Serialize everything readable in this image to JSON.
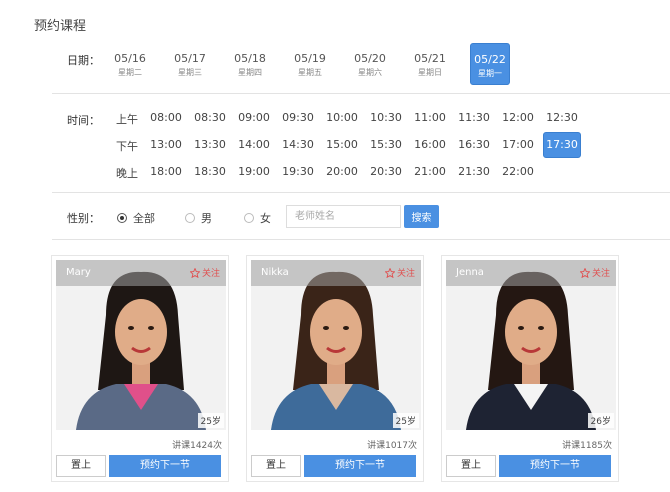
{
  "page_title": "预约课程",
  "dates": {
    "label": "日期：",
    "items": [
      {
        "date": "05/16",
        "weekday": "星期二",
        "active": false
      },
      {
        "date": "05/17",
        "weekday": "星期三",
        "active": false
      },
      {
        "date": "05/18",
        "weekday": "星期四",
        "active": false
      },
      {
        "date": "05/19",
        "weekday": "星期五",
        "active": false
      },
      {
        "date": "05/20",
        "weekday": "星期六",
        "active": false
      },
      {
        "date": "05/21",
        "weekday": "星期日",
        "active": false
      },
      {
        "date": "05/22",
        "weekday": "星期一",
        "active": true
      }
    ]
  },
  "times": {
    "label": "时间：",
    "periods": [
      {
        "name": "上午",
        "slots": [
          "08:00",
          "08:30",
          "09:00",
          "09:30",
          "10:00",
          "10:30",
          "11:00",
          "11:30",
          "12:00",
          "12:30"
        ]
      },
      {
        "name": "下午",
        "slots": [
          "13:00",
          "13:30",
          "14:00",
          "14:30",
          "15:00",
          "15:30",
          "16:00",
          "16:30",
          "17:00",
          "17:30"
        ]
      },
      {
        "name": "晚上",
        "slots": [
          "18:00",
          "18:30",
          "19:00",
          "19:30",
          "20:00",
          "20:30",
          "21:00",
          "21:30",
          "22:00"
        ]
      }
    ],
    "active_slot": "17:30"
  },
  "filter": {
    "label": "性别：",
    "options": [
      {
        "label": "全部",
        "checked": true
      },
      {
        "label": "男",
        "checked": false
      },
      {
        "label": "女",
        "checked": false
      }
    ],
    "search_placeholder": "老师姓名",
    "search_button": "搜索"
  },
  "teachers": [
    {
      "name": "Mary",
      "follow": "关注",
      "age": "25岁",
      "lessons": "讲课1424次",
      "top_label": "置上",
      "book_label": "预约下一节",
      "hair": "#1e1714",
      "shirt": "#e0508a",
      "jacket": "#5a6a86"
    },
    {
      "name": "Nikka",
      "follow": "关注",
      "age": "25岁",
      "lessons": "讲课1017次",
      "top_label": "置上",
      "book_label": "预约下一节",
      "hair": "#3a2418",
      "shirt": "#d9b8a0",
      "jacket": "#3e6b9a"
    },
    {
      "name": "Jenna",
      "follow": "关注",
      "age": "26岁",
      "lessons": "讲课1185次",
      "top_label": "置上",
      "book_label": "预约下一节",
      "hair": "#241712",
      "shirt": "#f4f4f4",
      "jacket": "#1e2333"
    }
  ],
  "colors": {
    "accent": "#4a90e2",
    "follow": "#e05050"
  }
}
